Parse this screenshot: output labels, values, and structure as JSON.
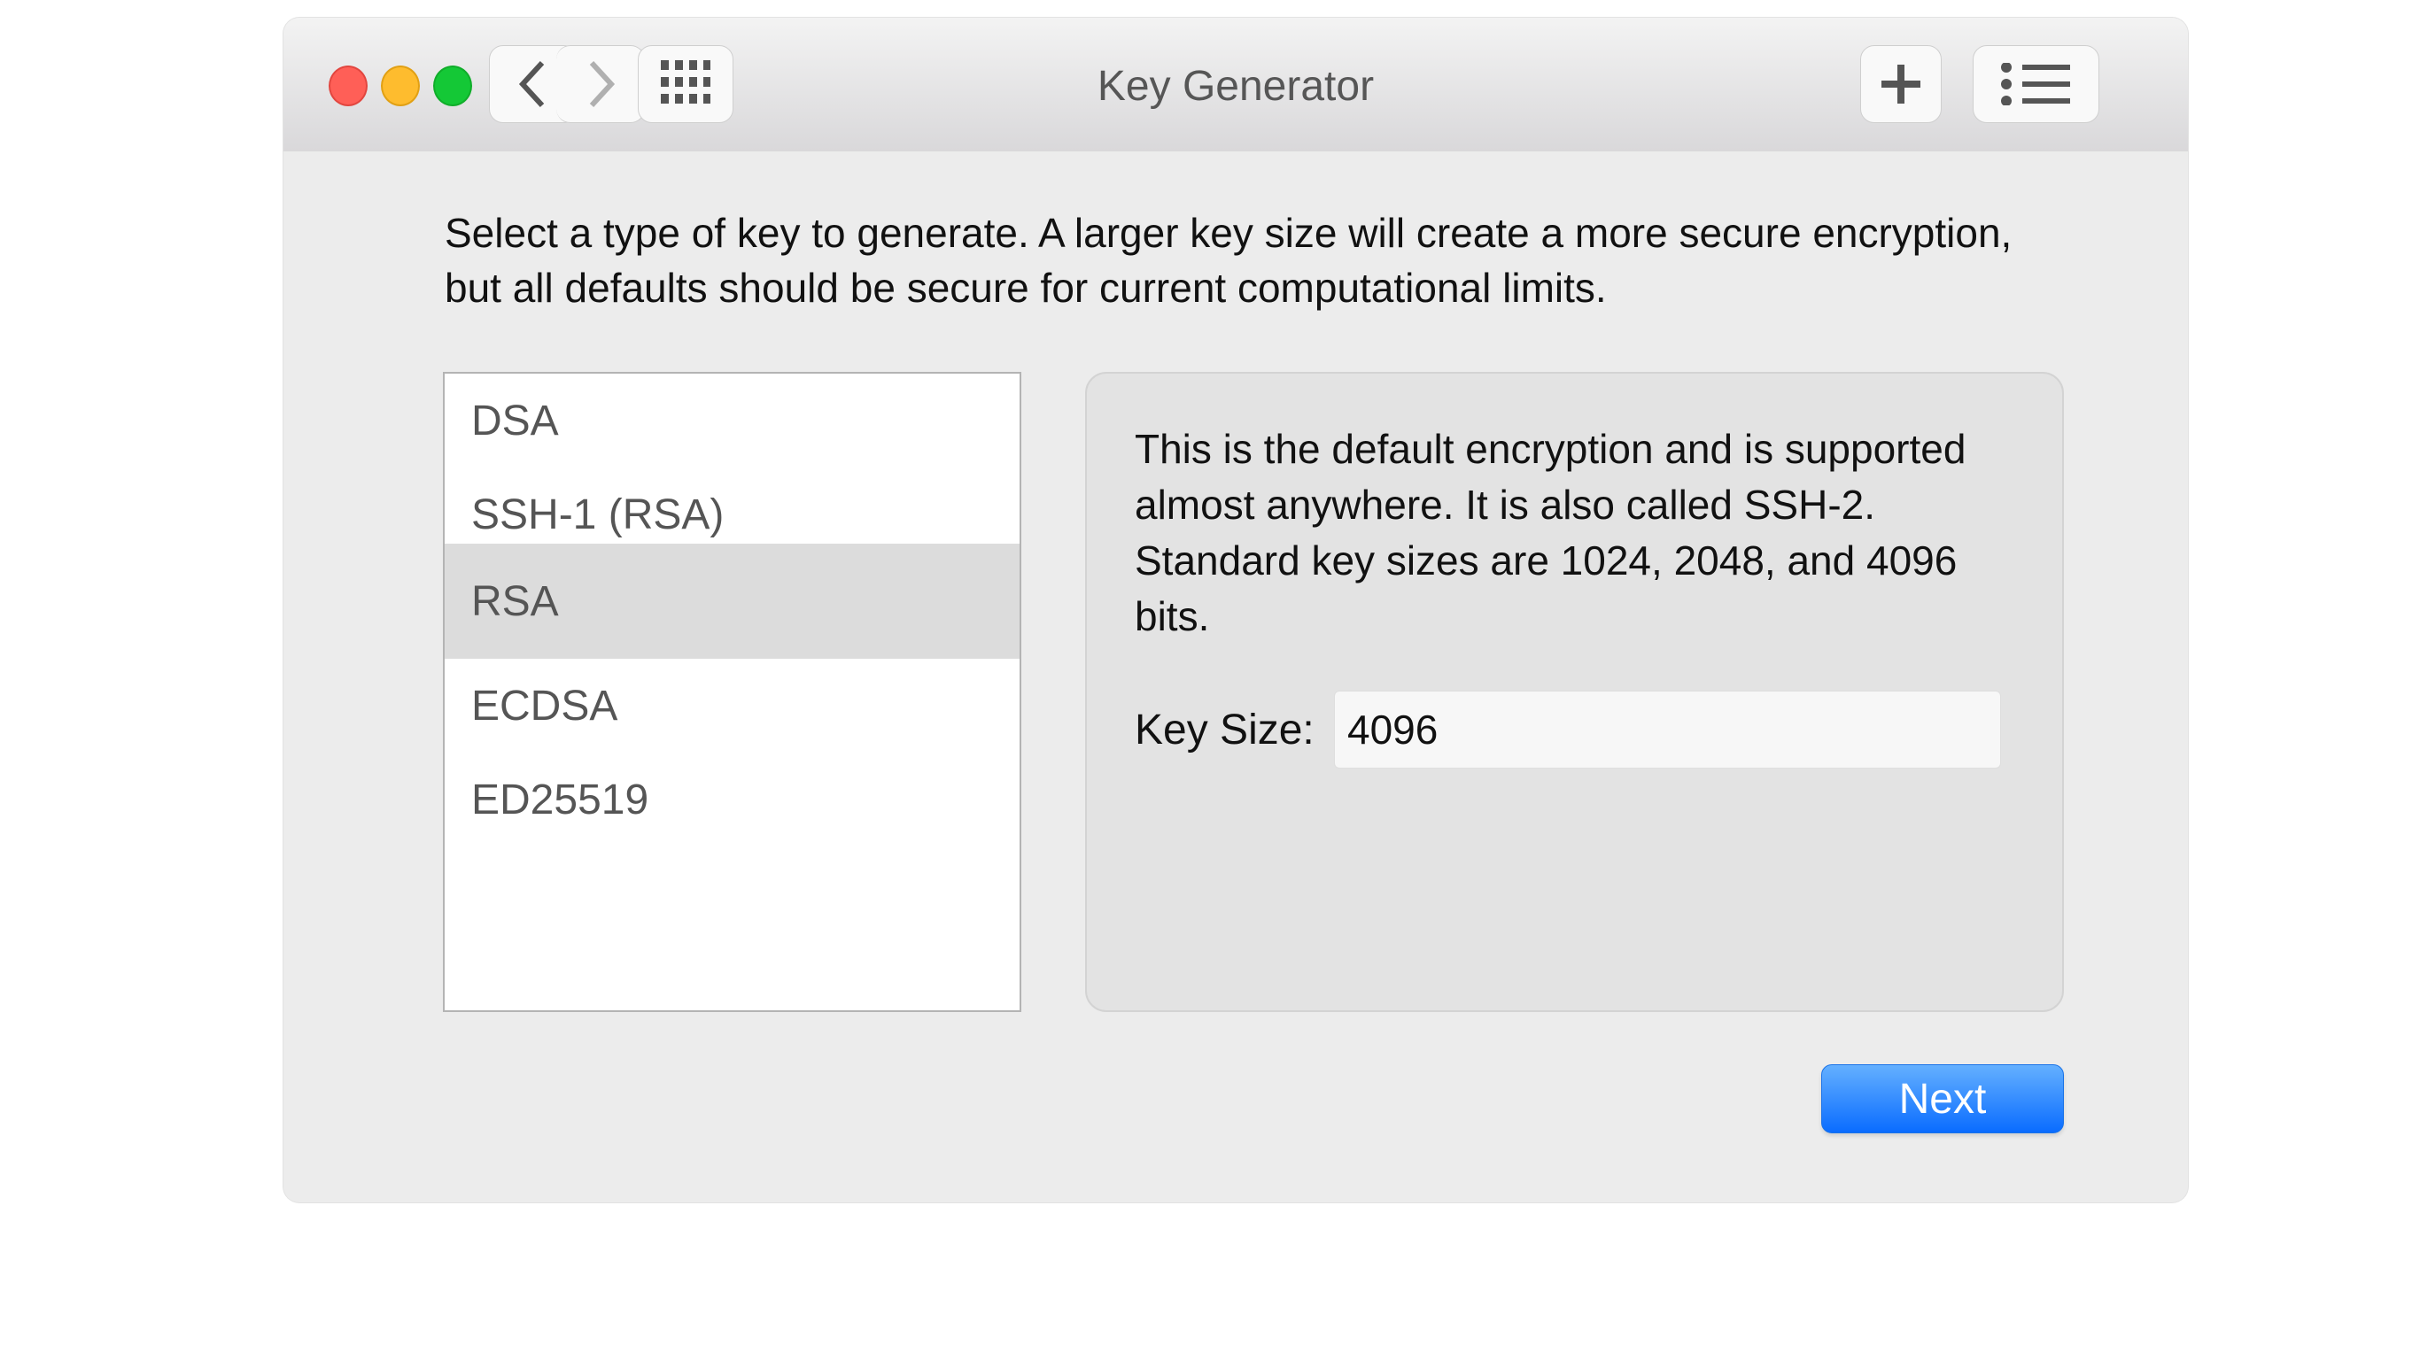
{
  "window": {
    "title": "Key Generator",
    "traffic_lights": {
      "close": "#ff5f57",
      "minimize": "#febc2e",
      "zoom": "#14c836"
    },
    "toolbar": {
      "back_icon": "chevron-left-icon",
      "forward_icon": "chevron-right-icon",
      "grid_icon": "grid-icon",
      "add_icon": "plus-icon",
      "list_icon": "list-icon"
    }
  },
  "instructions": "Select a type of key to generate. A larger key size will create a more secure encryption, but all defaults should be secure for current computational limits.",
  "key_types": {
    "items": [
      {
        "label": "DSA",
        "selected": false
      },
      {
        "label": "SSH-1 (RSA)",
        "selected": false
      },
      {
        "label": "RSA",
        "selected": true
      },
      {
        "label": "ECDSA",
        "selected": false
      },
      {
        "label": "ED25519",
        "selected": false
      }
    ]
  },
  "details": {
    "description": "This is the default encryption and is supported almost anywhere. It is also called SSH-2. Standard key sizes are 1024, 2048, and 4096 bits.",
    "key_size_label": "Key Size:",
    "key_size_value": "4096"
  },
  "actions": {
    "next_label": "Next",
    "accent_color": "#0a6cff"
  }
}
